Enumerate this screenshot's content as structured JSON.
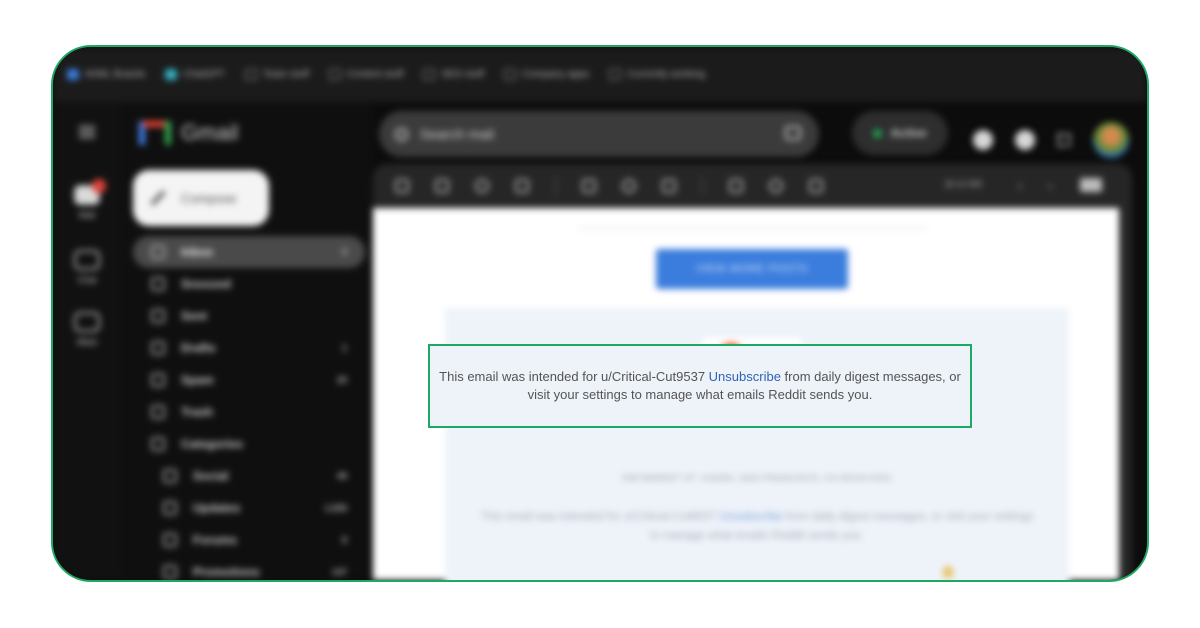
{
  "bookmarks": [
    "AI/ML Boards",
    "ChatGPT",
    "Team stuff",
    "Content stuff",
    "SEO stuff",
    "Company apps",
    "Currently working"
  ],
  "rail": [
    {
      "label": "Mail",
      "icon": "mail-icon"
    },
    {
      "label": "Chat",
      "icon": "chat-icon"
    },
    {
      "label": "Meet",
      "icon": "video-icon"
    }
  ],
  "app": {
    "name": "Gmail"
  },
  "compose": {
    "label": "Compose"
  },
  "nav": [
    {
      "label": "Inbox",
      "count": "9",
      "icon": "inbox-icon"
    },
    {
      "label": "Snoozed",
      "count": "",
      "icon": "clock-icon"
    },
    {
      "label": "Sent",
      "count": "",
      "icon": "send-icon"
    },
    {
      "label": "Drafts",
      "count": "1",
      "icon": "draft-icon"
    },
    {
      "label": "Spam",
      "count": "20",
      "icon": "spam-icon"
    },
    {
      "label": "Trash",
      "count": "",
      "icon": "trash-icon"
    },
    {
      "label": "Categories",
      "count": "",
      "icon": "label-icon"
    },
    {
      "label": "Social",
      "count": "49",
      "icon": "people-icon"
    },
    {
      "label": "Updates",
      "count": "1,026",
      "icon": "info-icon"
    },
    {
      "label": "Forums",
      "count": "8",
      "icon": "forum-icon"
    },
    {
      "label": "Promotions",
      "count": "147",
      "icon": "tag-icon"
    }
  ],
  "search": {
    "placeholder": "Search mail"
  },
  "status": {
    "label": "Active"
  },
  "toolbar": {
    "count": "26 of 435"
  },
  "email": {
    "button_label": "VIEW MORE POSTS",
    "brand": "reddit",
    "address": "548 MARKET ST. #16093, SAN FRANCISCO, CA 94104-5401",
    "notice": {
      "before": "This email was intended for u/Critical-Cut9537 ",
      "link": "Unsubscribe",
      "after": " from daily digest messages, or visit your settings to manage what emails Reddit sends you."
    }
  },
  "colors": {
    "highlight": "#1ea866",
    "link": "#2f63b4",
    "button": "#3b7ddd"
  }
}
